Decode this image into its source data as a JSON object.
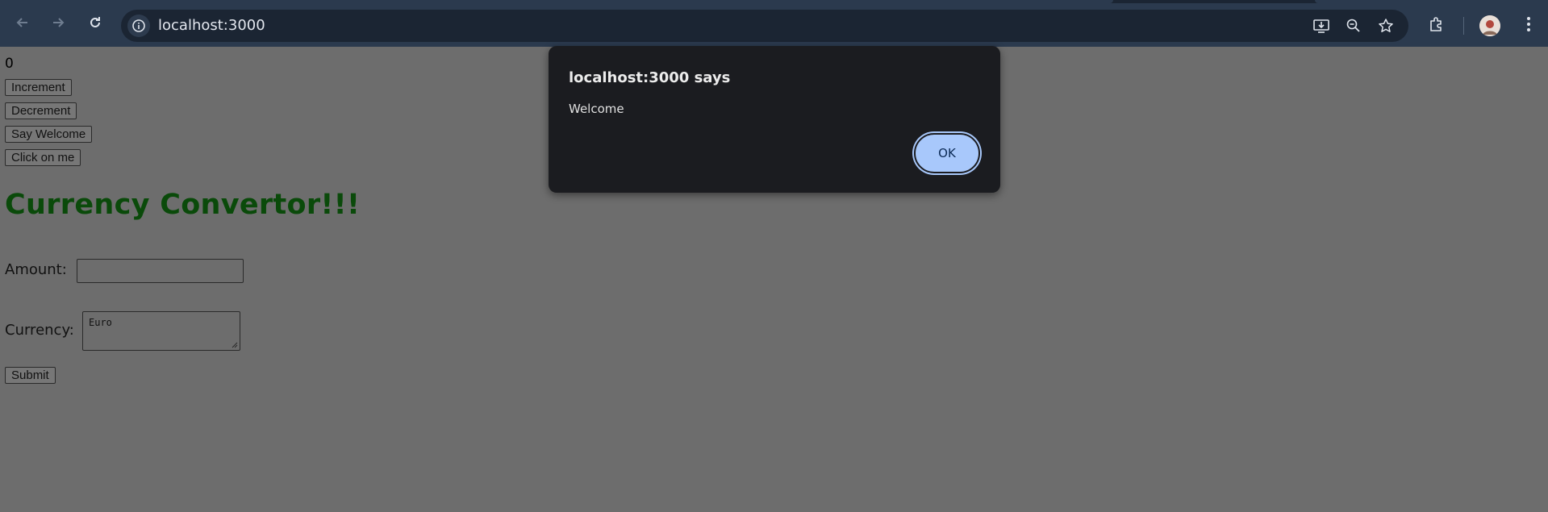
{
  "browser": {
    "url": "localhost:3000",
    "icons": {
      "back": "arrow-left-icon",
      "forward": "arrow-right-icon",
      "reload": "reload-icon",
      "site_info": "info-icon",
      "install": "install-app-icon",
      "zoom": "zoom-out-icon",
      "bookmark": "star-icon",
      "extensions": "puzzle-icon",
      "menu": "kebab-menu-icon"
    }
  },
  "page": {
    "counter_value": "0",
    "buttons": {
      "increment": "Increment",
      "decrement": "Decrement",
      "say_welcome": "Say Welcome",
      "click_on_me": "Click on me"
    },
    "heading": "Currency Convertor!!!",
    "form": {
      "amount_label": "Amount:",
      "amount_value": "",
      "currency_label": "Currency:",
      "currency_value": "Euro",
      "submit_label": "Submit"
    }
  },
  "dialog": {
    "title": "localhost:3000 says",
    "message": "Welcome",
    "ok_label": "OK"
  },
  "colors": {
    "heading_green": "#0a4a0a",
    "ok_button": "#a8c8fb",
    "dialog_bg": "#1b1c20",
    "overlay_bg": "#6d6d6d"
  }
}
